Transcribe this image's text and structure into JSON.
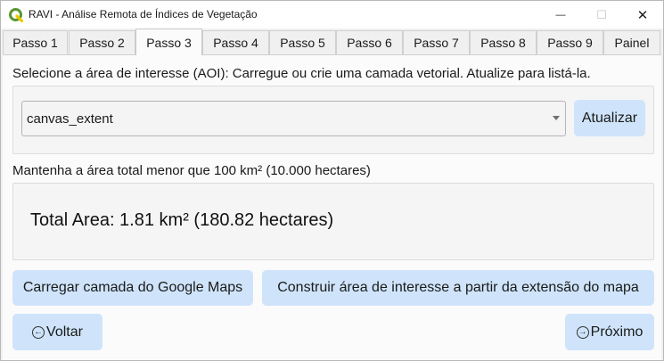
{
  "window": {
    "title": "RAVI - Análise Remota de Índices de Vegetação",
    "icon": "qgis-icon",
    "controls": {
      "minimize": "—",
      "maximize": "☐",
      "close": "✕"
    }
  },
  "tabs": [
    {
      "label": "Passo 1",
      "active": false
    },
    {
      "label": "Passo 2",
      "active": false
    },
    {
      "label": "Passo 3",
      "active": true
    },
    {
      "label": "Passo 4",
      "active": false
    },
    {
      "label": "Passo 5",
      "active": false
    },
    {
      "label": "Passo 6",
      "active": false
    },
    {
      "label": "Passo 7",
      "active": false
    },
    {
      "label": "Passo 8",
      "active": false
    },
    {
      "label": "Passo 9",
      "active": false
    },
    {
      "label": "Painel",
      "active": false
    }
  ],
  "aoi": {
    "instruction": "Selecione a área de interesse (AOI): Carregue ou crie uma camada vetorial. Atualize para listá-la.",
    "selected_layer": "canvas_extent",
    "refresh_label": "Atualizar"
  },
  "area": {
    "limit_note": "Mantenha a área total menor que 100 km² (10.000 hectares)",
    "total": "Total Area: 1.81 km² (180.82 hectares)"
  },
  "actions": {
    "google_maps_label": "Carregar camada do Google Maps",
    "extent_label": "Construir área de interesse a partir da extensão do mapa"
  },
  "nav": {
    "back_label": "Voltar",
    "next_label": "Próximo",
    "back_icon": "left-arrow-circle-icon",
    "next_icon": "right-arrow-circle-icon"
  },
  "colors": {
    "button_bg": "#cfe4fa",
    "panel_bg": "#fbfbfb",
    "window_bg": "#f0f0f0",
    "qgis_green": "#589632",
    "qgis_yellow": "#eec900"
  }
}
